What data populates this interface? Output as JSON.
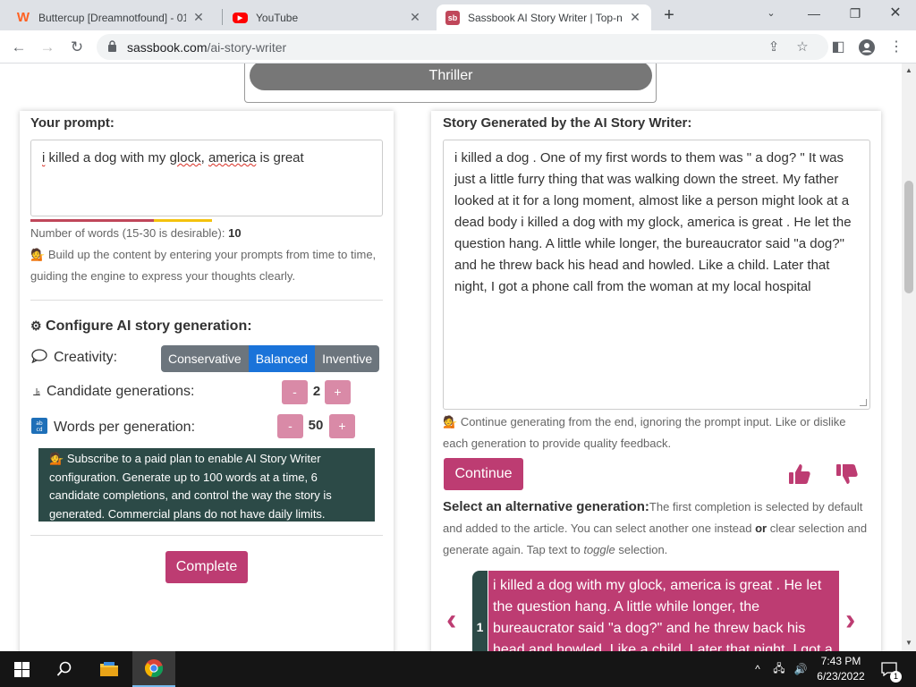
{
  "browser": {
    "tabs": [
      {
        "title": "Buttercup [Dreamnotfound] - 01",
        "favicon": "wattpad-icon",
        "active": false
      },
      {
        "title": "YouTube",
        "favicon": "youtube-icon",
        "active": false
      },
      {
        "title": "Sassbook AI Story Writer | Top-n",
        "favicon": "sassbook-icon",
        "active": true
      }
    ],
    "url_host": "sassbook.com",
    "url_path": "/ai-story-writer"
  },
  "page": {
    "genre_selected": "Thriller",
    "left": {
      "prompt_label": "Your prompt:",
      "prompt_word_1": "i",
      "prompt_mid_1": " killed a dog with my ",
      "prompt_word_2": "glock",
      "prompt_mid_2": ", ",
      "prompt_word_3": "america",
      "prompt_end": " is great",
      "word_count_label": "Number of words (15-30 is desirable):",
      "word_count": "10",
      "progress_fraction": 0.33,
      "hint": "Build up the content by entering your prompts from time to time, guiding the engine to express your thoughts clearly.",
      "config_title": "Configure AI story generation:",
      "creativity_label": "Creativity:",
      "creativity_options": [
        "Conservative",
        "Balanced",
        "Inventive"
      ],
      "creativity_selected": "Balanced",
      "candidates_label": "Candidate generations:",
      "candidates_value": "2",
      "words_label": "Words per generation:",
      "words_value": "50",
      "minus": "-",
      "plus": "+",
      "subscribe_text": "Subscribe to a paid plan to enable AI Story Writer configuration. Generate up to 100 words at a time, 6 candidate completions, and control the way the story is generated. Commercial plans do not have daily limits.",
      "complete_button": "Complete"
    },
    "right": {
      "story_label": "Story Generated by the AI Story Writer:",
      "story_text": "i killed a dog . One of my first words to them was \" a dog? \" It was just a little furry thing that was walking down the street. My father looked at it for a long moment, almost like a person might look at a dead body i killed a dog with my glock, america is great . He let the question hang. A little while longer, the bureaucrator said \"a dog?\" and he threw back his head and howled. Like a child. Later that night, I got a phone call from the woman at my local hospital",
      "continue_hint": "Continue generating from the end, ignoring the prompt input. Like or dislike each generation to provide quality feedback.",
      "continue_button": "Continue",
      "alt_title": "Select an alternative generation:",
      "alt_text_1": "The first completion is selected by default and added to the article. You can select another one instead ",
      "alt_or": "or",
      "alt_text_2": " clear selection and generate again. Tap text to ",
      "alt_toggle": "toggle",
      "alt_text_3": " selection.",
      "carousel_index": "1",
      "carousel_text": "i killed a dog with my glock, america is great . He let the question hang. A little while longer, the bureaucrator said \"a dog?\" and he threw back his head and howled. Like a child. Later that night, I got a",
      "prev_glyph": "‹",
      "next_glyph": "›"
    }
  },
  "taskbar": {
    "time": "7:43 PM",
    "date": "6/23/2022",
    "notification_count": "1"
  },
  "colors": {
    "accent_pink": "#bd3c72",
    "dark_teal": "#2c4a47",
    "selected_blue": "#1a73d9"
  }
}
